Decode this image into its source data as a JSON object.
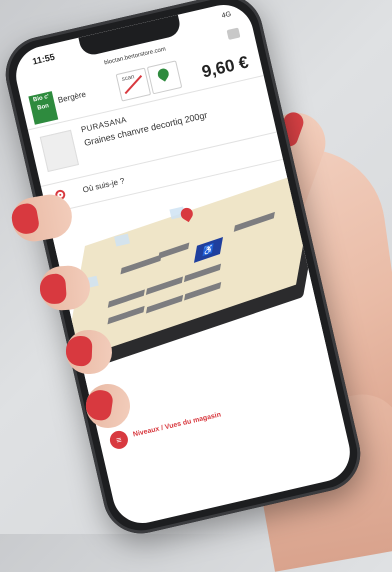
{
  "status": {
    "time": "11:55",
    "network": "4G"
  },
  "browser": {
    "url": "bloctan.bertorstore.com"
  },
  "store": {
    "logo_text": "Bio c' Bon",
    "name": "Bergère",
    "scan_tab_label": "scan",
    "price": "9,60 €"
  },
  "product": {
    "brand": "PURASANA",
    "name": "Graines chanvre decortiq 200gr"
  },
  "locate": {
    "label": "Où suis-je ?"
  },
  "map": {
    "accessibility_symbol": "♿"
  },
  "footer": {
    "link_label": "Niveaux / Vues du magasin"
  },
  "colors": {
    "accent": "#d8393f",
    "brand_green": "#2e8b3e",
    "floor": "#efe5c8"
  }
}
